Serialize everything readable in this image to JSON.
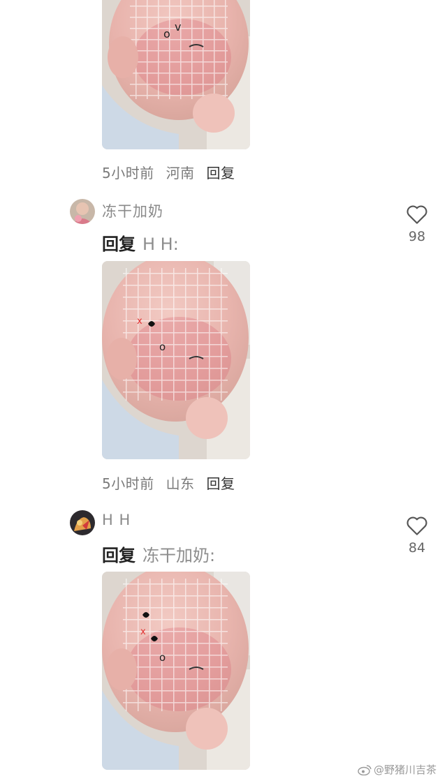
{
  "comments": [
    {
      "time": "5小时前",
      "location": "河南",
      "reply_label": "回复"
    },
    {
      "username": "冻干加奶",
      "reply_word": "回复",
      "reply_target": "H H:",
      "likes": "98",
      "time": "5小时前",
      "location": "山东",
      "reply_label": "回复"
    },
    {
      "username": "H H",
      "reply_word": "回复",
      "reply_target": "冻干加奶:",
      "likes": "84"
    }
  ],
  "icons": {
    "like": "heart-icon",
    "weibo": "weibo-logo-icon"
  },
  "colors": {
    "username": "#8a8a8a",
    "meta": "#7a7a7a",
    "heart": "#555555"
  },
  "watermark": "@野猪川吉茶"
}
